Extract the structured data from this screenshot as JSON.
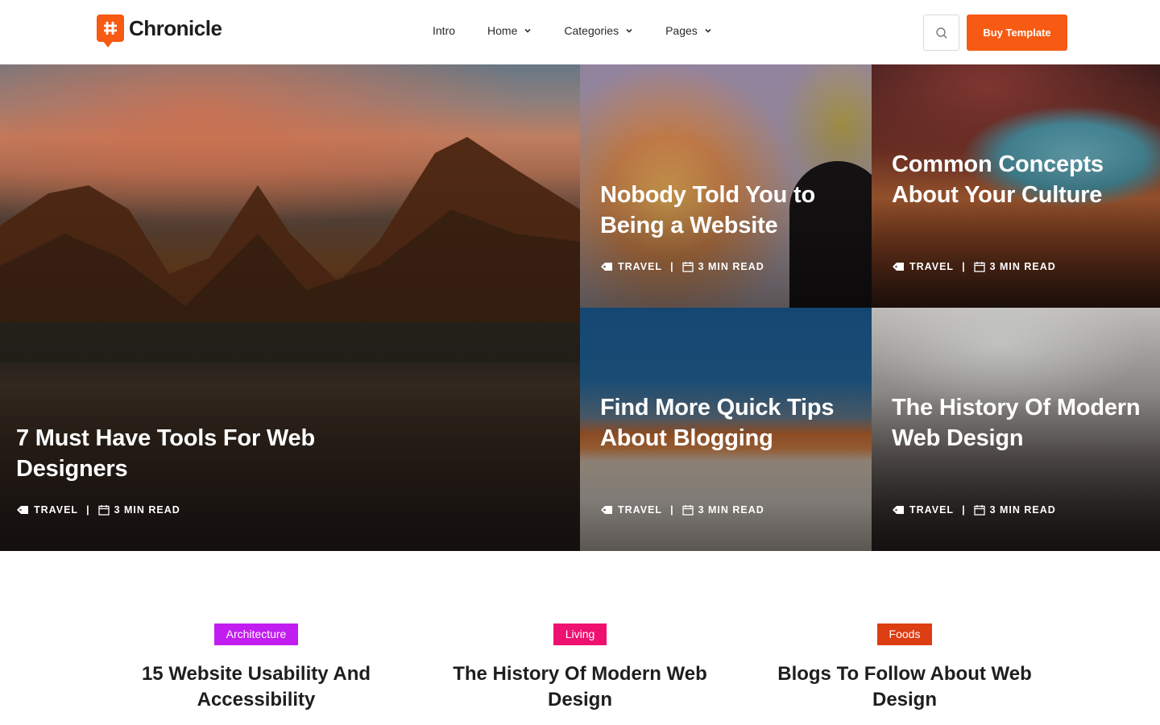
{
  "header": {
    "logo_text": "Chronicle",
    "nav": [
      {
        "label": "Intro",
        "has_dropdown": false
      },
      {
        "label": "Home",
        "has_dropdown": true
      },
      {
        "label": "Categories",
        "has_dropdown": true
      },
      {
        "label": "Pages",
        "has_dropdown": true
      }
    ],
    "buy_label": "Buy Template",
    "accent_color": "#f75a12"
  },
  "hero": {
    "featured": {
      "title": "7 Must Have Tools For Web Designers",
      "category": "TRAVEL",
      "read_time": "3 MIN READ"
    },
    "cards": [
      {
        "title": "Nobody Told You to Being a Website",
        "category": "TRAVEL",
        "read_time": "3 MIN READ"
      },
      {
        "title": "Common Concepts About Your Culture",
        "category": "TRAVEL",
        "read_time": "3 MIN READ"
      },
      {
        "title": "Find More Quick Tips About Blogging",
        "category": "TRAVEL",
        "read_time": "3 MIN READ"
      },
      {
        "title": "The History Of Modern Web Design",
        "category": "TRAVEL",
        "read_time": "3 MIN READ"
      }
    ]
  },
  "posts": [
    {
      "badge": "Architecture",
      "badge_color": "#c21df0",
      "title": "15 Website Usability And Accessibility"
    },
    {
      "badge": "Living",
      "badge_color": "#ee1170",
      "title": "The History Of Modern Web Design"
    },
    {
      "badge": "Foods",
      "badge_color": "#dd3d12",
      "title": "Blogs To Follow About Web Design"
    }
  ]
}
